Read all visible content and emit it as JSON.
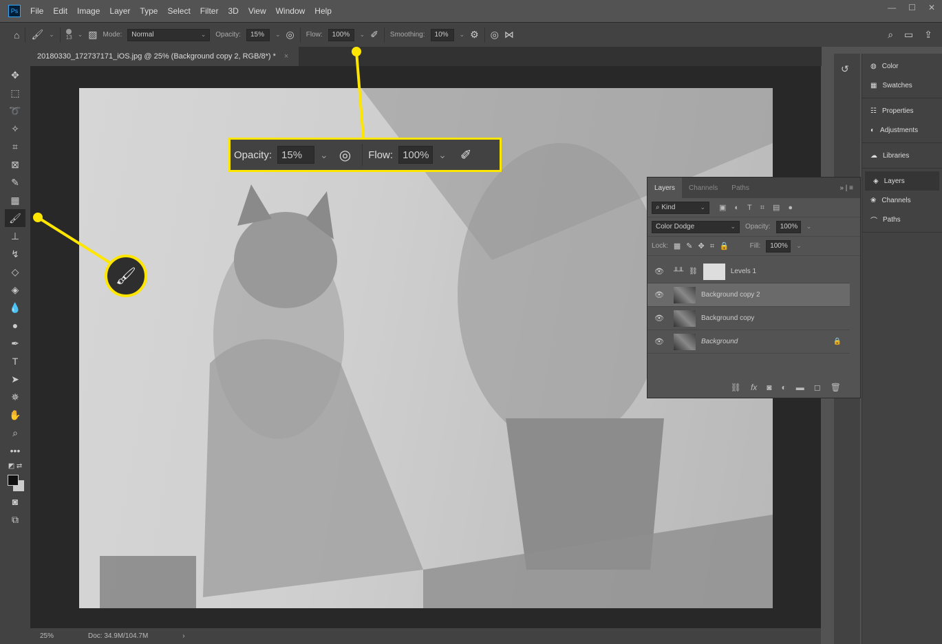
{
  "app": {
    "logo": "Ps",
    "menu": [
      "File",
      "Edit",
      "Image",
      "Layer",
      "Type",
      "Select",
      "Filter",
      "3D",
      "View",
      "Window",
      "Help"
    ]
  },
  "options": {
    "brush_size": "13",
    "mode_label": "Mode:",
    "mode": "Normal",
    "opacity_label": "Opacity:",
    "opacity": "15%",
    "flow_label": "Flow:",
    "flow": "100%",
    "smoothing_label": "Smoothing:",
    "smoothing": "10%"
  },
  "document": {
    "tab_title": "20180330_172737171_iOS.jpg @ 25% (Background copy 2, RGB/8*) *",
    "close": "×"
  },
  "status": {
    "zoom": "25%",
    "doc": "Doc: 34.9M/104.7M",
    "arrow": "›"
  },
  "right_panel": {
    "groups": [
      [
        "Color",
        "Swatches"
      ],
      [
        "Properties",
        "Adjustments"
      ],
      [
        "Libraries"
      ],
      [
        "Layers",
        "Channels",
        "Paths"
      ]
    ]
  },
  "layers_panel": {
    "tabs": [
      "Layers",
      "Channels",
      "Paths"
    ],
    "filter": "Kind",
    "blend_mode": "Color Dodge",
    "opacity_label": "Opacity:",
    "opacity": "100%",
    "lock_label": "Lock:",
    "fill_label": "Fill:",
    "fill": "100%",
    "layers": [
      {
        "name": "Levels 1"
      },
      {
        "name": "Background copy 2",
        "selected": true
      },
      {
        "name": "Background copy"
      },
      {
        "name": "Background",
        "locked": true
      }
    ]
  },
  "callout": {
    "opacity_label": "Opacity:",
    "opacity": "15%",
    "flow_label": "Flow:",
    "flow": "100%"
  },
  "colors": {
    "highlight": "#ffe600",
    "ui_bg": "#535353",
    "panel_bg": "#424242"
  }
}
